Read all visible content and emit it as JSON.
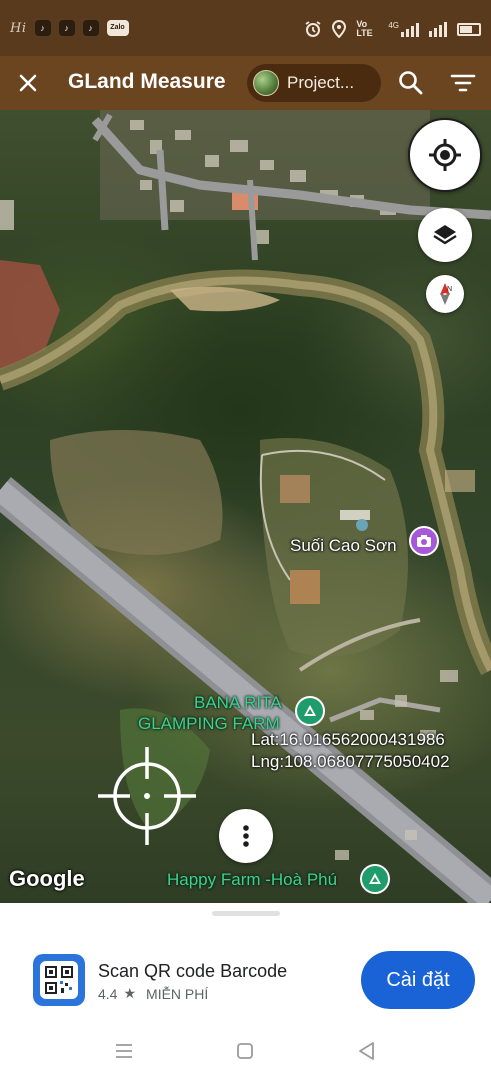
{
  "status_bar": {
    "handwriting": "Hi",
    "app_icons": [
      "tiktok-icon",
      "tiktok-icon",
      "tiktok-icon",
      "zalo-icon"
    ],
    "zalo_label": "Zalo",
    "network_label": "Vo LTE",
    "signal_label": "4G",
    "right_icons": [
      "alarm-icon",
      "location-icon",
      "signal-icon",
      "wifi-icon",
      "battery-icon"
    ]
  },
  "app_bar": {
    "title": "GLand Measure",
    "project_label": "Project...",
    "close_icon": "close-icon",
    "search_icon": "search-icon",
    "menu_icon": "filter-menu-icon"
  },
  "map": {
    "labels": {
      "suoi_cao_son": "Suối Cao Sơn",
      "bana_rita_line1": "BANA RITA",
      "bana_rita_line2": "GLAMPING FARM",
      "happy_farm": "Happy Farm -Hoà Phú"
    },
    "coordinates": {
      "lat_text": "Lat:16.016562000431986",
      "lng_text": "Lng:108.06807775050402"
    },
    "attribution": "Google",
    "buttons": {
      "locate_icon": "my-location-icon",
      "layers_icon": "layers-icon",
      "compass_icon": "compass-icon",
      "more_icon": "more-vertical-icon"
    },
    "accent_colors": {
      "poi_green": "#1f9c6c",
      "poi_purple": "#a658d6",
      "label_green": "#3dd18f"
    }
  },
  "ad": {
    "title": "Scan QR code Barcode",
    "rating": "4.4",
    "star": "★",
    "price_label": "MIỄN PHÍ",
    "install_label": "Cài đặt",
    "install_color": "#1a63d6"
  },
  "nav_bar": {
    "icons": [
      "recent-apps-icon",
      "home-icon",
      "back-icon"
    ]
  }
}
